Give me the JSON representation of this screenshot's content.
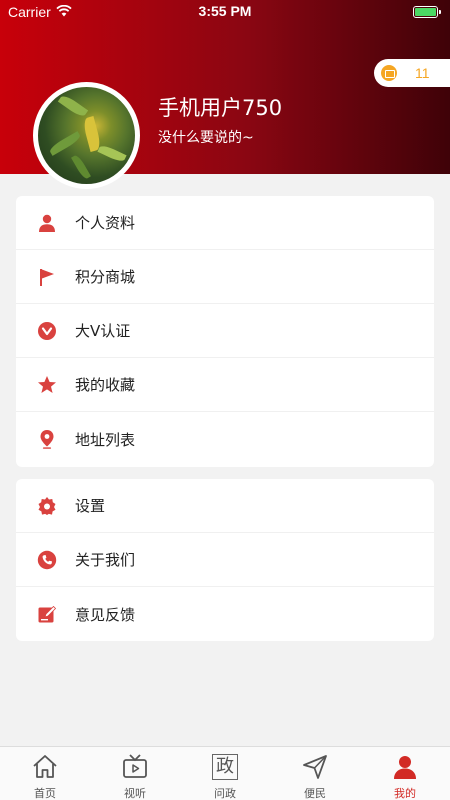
{
  "status_bar": {
    "carrier": "Carrier",
    "time": "3:55 PM"
  },
  "header": {
    "username": "手机用户750",
    "bio": "没什么要说的~",
    "coins": "11",
    "gradient_colors": [
      "#c8000a",
      "#3f0208"
    ]
  },
  "menu_group_1": [
    {
      "label": "个人资料",
      "icon": "person-icon"
    },
    {
      "label": "积分商城",
      "icon": "flag-icon"
    },
    {
      "label": "大V认证",
      "icon": "verified-v-icon"
    },
    {
      "label": "我的收藏",
      "icon": "star-icon"
    },
    {
      "label": "地址列表",
      "icon": "location-pin-icon"
    }
  ],
  "menu_group_2": [
    {
      "label": "设置",
      "icon": "gear-icon"
    },
    {
      "label": "关于我们",
      "icon": "phone-icon"
    },
    {
      "label": "意见反馈",
      "icon": "edit-icon"
    }
  ],
  "tabbar": {
    "tabs": [
      {
        "label": "首页",
        "icon": "home-icon"
      },
      {
        "label": "视听",
        "icon": "tv-icon"
      },
      {
        "label": "问政",
        "icon": "zheng-icon",
        "glyph": "政"
      },
      {
        "label": "便民",
        "icon": "paper-plane-icon"
      },
      {
        "label": "我的",
        "icon": "user-profile-icon",
        "active": true
      }
    ]
  },
  "colors": {
    "accent": "#d22a25",
    "icon_red": "#d9423f",
    "coin": "#f5a623",
    "background": "#f2f2f2"
  }
}
